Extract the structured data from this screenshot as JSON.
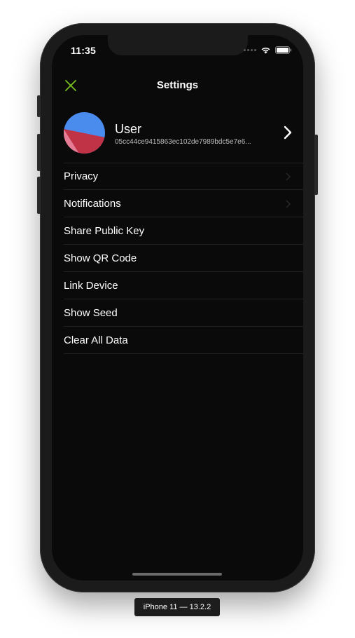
{
  "status_bar": {
    "time": "11:35",
    "icons": [
      "signal-icon",
      "wifi-icon",
      "battery-icon"
    ]
  },
  "nav": {
    "title": "Settings",
    "close_icon": "close-icon"
  },
  "profile": {
    "name": "User",
    "public_key": "05cc44ce9415863ec102de7989bdc5e7e6...",
    "chevron_icon": "chevron-right-icon"
  },
  "settings": {
    "items": [
      {
        "label": "Privacy",
        "has_chevron": true
      },
      {
        "label": "Notifications",
        "has_chevron": true
      },
      {
        "label": "Share Public Key",
        "has_chevron": false
      },
      {
        "label": "Show QR Code",
        "has_chevron": false
      },
      {
        "label": "Link Device",
        "has_chevron": false
      },
      {
        "label": "Show Seed",
        "has_chevron": false
      },
      {
        "label": "Clear All Data",
        "has_chevron": false
      }
    ]
  },
  "simulator": {
    "device_label": "iPhone 11 — 13.2.2"
  },
  "colors": {
    "accent": "#78be20",
    "background": "#0a0a0a",
    "text": "#ffffff",
    "separator": "#222222"
  }
}
